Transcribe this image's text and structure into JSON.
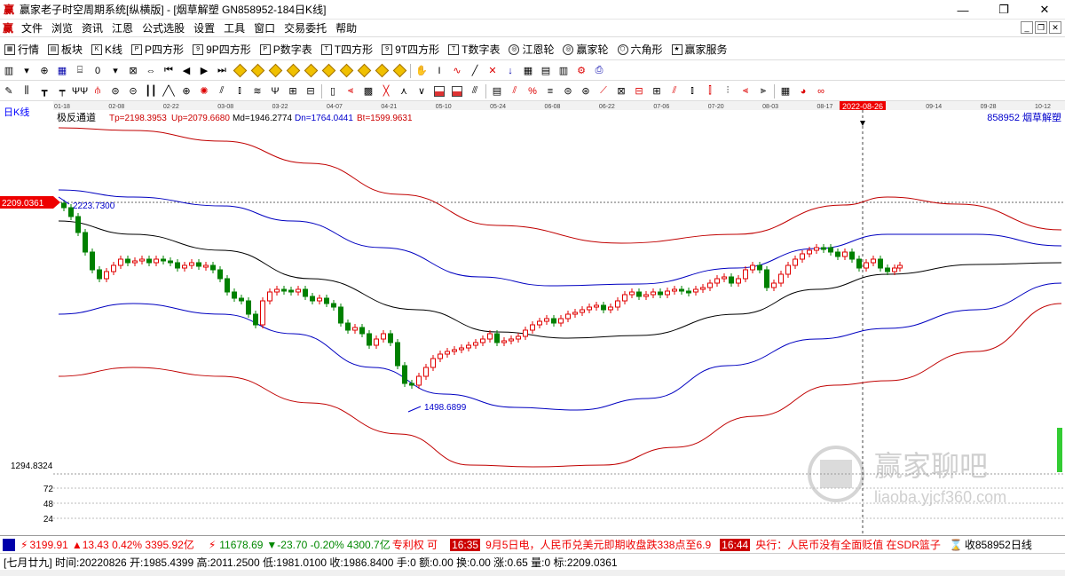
{
  "window": {
    "app_icon": "yingjia-logo-icon",
    "title": "赢家老子时空周期系统[纵横版] - [烟草解塑  GN858952-184日K线]",
    "buttons": [
      "—",
      "❐",
      "✕"
    ]
  },
  "menu": {
    "items": [
      "文件",
      "浏览",
      "资讯",
      "江恩",
      "公式选股",
      "设置",
      "工具",
      "窗口",
      "交易委托",
      "帮助"
    ]
  },
  "toolbar1": {
    "items": [
      {
        "icon": "grid-icon",
        "label": "行情"
      },
      {
        "icon": "block-icon",
        "label": "板块"
      },
      {
        "icon": "kline-icon",
        "label": "K线"
      },
      {
        "icon": "p-square-icon",
        "label": "P四方形"
      },
      {
        "icon": "9p-square-icon",
        "label": "9P四方形"
      },
      {
        "icon": "p-table-icon",
        "label": "P数字表"
      },
      {
        "icon": "t-square-icon",
        "label": "T四方形"
      },
      {
        "icon": "9t-square-icon",
        "label": "9T四方形"
      },
      {
        "icon": "t-table-icon",
        "label": "T数字表"
      },
      {
        "icon": "jiangen-wheel-icon",
        "label": "江恩轮"
      },
      {
        "icon": "yingjia-wheel-icon",
        "label": "赢家轮"
      },
      {
        "icon": "hexagon-icon",
        "label": "六角形"
      },
      {
        "icon": "service-icon",
        "label": "赢家服务"
      }
    ]
  },
  "chart": {
    "period_label": "日K线",
    "indicator_name": "极反通道",
    "tp": "Tp=2198.3953",
    "up": "Up=2079.6680",
    "md": "Md=1946.2774",
    "dn": "Dn=1764.0441",
    "bt": "Bt=1599.9631",
    "stock_label": "858952  烟草解塑",
    "price_tag": "2209.0361",
    "high_label": "2223.7300",
    "low_label": "1498.6899",
    "axis_value_low": "1294.8324",
    "volume_ticks": [
      "72",
      "48",
      "24"
    ],
    "date_ticks": [
      "01-18",
      "02-08",
      "02-22",
      "03-08",
      "03-22",
      "04-07",
      "04-21",
      "05-10",
      "05-24",
      "06-08",
      "06-22",
      "07-06",
      "07-20",
      "08-03",
      "08-17",
      "2022-08-26",
      "09-14",
      "09-28",
      "10-12"
    ],
    "highlight_date": "2022-08-26",
    "colors": {
      "up": "#e00000",
      "down": "#008000",
      "outer": "#c00000",
      "inner": "#0000c0",
      "mid": "#000000"
    },
    "watermark_title": "赢家聊吧",
    "watermark_url": "liaoba.yjcf360.com"
  },
  "chart_data": {
    "type": "candlestick",
    "title": "",
    "series": [
      {
        "name": "Tp",
        "value": 2198.3953
      },
      {
        "name": "Up",
        "value": 2079.668
      },
      {
        "name": "Md",
        "value": 1946.2774
      },
      {
        "name": "Dn",
        "value": 1764.0441
      },
      {
        "name": "Bt",
        "value": 1599.9631
      }
    ],
    "last_close": 2209.0361,
    "period_high": 2223.73,
    "period_low": 1498.6899,
    "axis_low_label": 1294.8324
  },
  "statusbar": {
    "sh_index": "3199.91",
    "sh_change": "▲13.43 0.42% 3395.92亿",
    "sz_index": "11678.69",
    "sz_change": "▼-23.70 -0.20% 4300.7亿",
    "news_tag1": "专利权 可",
    "news_time1": "16:35",
    "news_text1": "9月5日电，人民币兑美元即期收盘跌338点至6.9",
    "news_time2": "16:44",
    "news_text2": "央行：人民币没有全面贬值 在SDR篮子",
    "right_info": "收858952日线"
  },
  "infobar": {
    "text": "[七月廿九] 时间:20220826 开:1985.4399 高:2011.2500 低:1981.0100 收:1986.8400 手:0 额:0.00 换:0.00 涨:0.65 量:0 标:2209.0361"
  }
}
